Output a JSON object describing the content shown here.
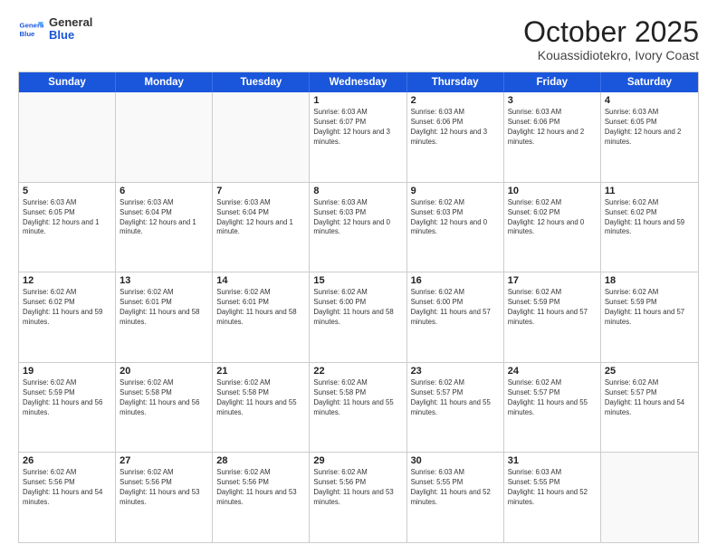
{
  "logo": {
    "line1": "General",
    "line2": "Blue"
  },
  "title": "October 2025",
  "location": "Kouassidiotekro, Ivory Coast",
  "weekdays": [
    "Sunday",
    "Monday",
    "Tuesday",
    "Wednesday",
    "Thursday",
    "Friday",
    "Saturday"
  ],
  "weeks": [
    [
      {
        "day": "",
        "empty": true
      },
      {
        "day": "",
        "empty": true
      },
      {
        "day": "",
        "empty": true
      },
      {
        "day": "1",
        "sunrise": "6:03 AM",
        "sunset": "6:07 PM",
        "daylight": "12 hours and 3 minutes."
      },
      {
        "day": "2",
        "sunrise": "6:03 AM",
        "sunset": "6:06 PM",
        "daylight": "12 hours and 3 minutes."
      },
      {
        "day": "3",
        "sunrise": "6:03 AM",
        "sunset": "6:06 PM",
        "daylight": "12 hours and 2 minutes."
      },
      {
        "day": "4",
        "sunrise": "6:03 AM",
        "sunset": "6:05 PM",
        "daylight": "12 hours and 2 minutes."
      }
    ],
    [
      {
        "day": "5",
        "sunrise": "6:03 AM",
        "sunset": "6:05 PM",
        "daylight": "12 hours and 1 minute."
      },
      {
        "day": "6",
        "sunrise": "6:03 AM",
        "sunset": "6:04 PM",
        "daylight": "12 hours and 1 minute."
      },
      {
        "day": "7",
        "sunrise": "6:03 AM",
        "sunset": "6:04 PM",
        "daylight": "12 hours and 1 minute."
      },
      {
        "day": "8",
        "sunrise": "6:03 AM",
        "sunset": "6:03 PM",
        "daylight": "12 hours and 0 minutes."
      },
      {
        "day": "9",
        "sunrise": "6:02 AM",
        "sunset": "6:03 PM",
        "daylight": "12 hours and 0 minutes."
      },
      {
        "day": "10",
        "sunrise": "6:02 AM",
        "sunset": "6:02 PM",
        "daylight": "12 hours and 0 minutes."
      },
      {
        "day": "11",
        "sunrise": "6:02 AM",
        "sunset": "6:02 PM",
        "daylight": "11 hours and 59 minutes."
      }
    ],
    [
      {
        "day": "12",
        "sunrise": "6:02 AM",
        "sunset": "6:02 PM",
        "daylight": "11 hours and 59 minutes."
      },
      {
        "day": "13",
        "sunrise": "6:02 AM",
        "sunset": "6:01 PM",
        "daylight": "11 hours and 58 minutes."
      },
      {
        "day": "14",
        "sunrise": "6:02 AM",
        "sunset": "6:01 PM",
        "daylight": "11 hours and 58 minutes."
      },
      {
        "day": "15",
        "sunrise": "6:02 AM",
        "sunset": "6:00 PM",
        "daylight": "11 hours and 58 minutes."
      },
      {
        "day": "16",
        "sunrise": "6:02 AM",
        "sunset": "6:00 PM",
        "daylight": "11 hours and 57 minutes."
      },
      {
        "day": "17",
        "sunrise": "6:02 AM",
        "sunset": "5:59 PM",
        "daylight": "11 hours and 57 minutes."
      },
      {
        "day": "18",
        "sunrise": "6:02 AM",
        "sunset": "5:59 PM",
        "daylight": "11 hours and 57 minutes."
      }
    ],
    [
      {
        "day": "19",
        "sunrise": "6:02 AM",
        "sunset": "5:59 PM",
        "daylight": "11 hours and 56 minutes."
      },
      {
        "day": "20",
        "sunrise": "6:02 AM",
        "sunset": "5:58 PM",
        "daylight": "11 hours and 56 minutes."
      },
      {
        "day": "21",
        "sunrise": "6:02 AM",
        "sunset": "5:58 PM",
        "daylight": "11 hours and 55 minutes."
      },
      {
        "day": "22",
        "sunrise": "6:02 AM",
        "sunset": "5:58 PM",
        "daylight": "11 hours and 55 minutes."
      },
      {
        "day": "23",
        "sunrise": "6:02 AM",
        "sunset": "5:57 PM",
        "daylight": "11 hours and 55 minutes."
      },
      {
        "day": "24",
        "sunrise": "6:02 AM",
        "sunset": "5:57 PM",
        "daylight": "11 hours and 55 minutes."
      },
      {
        "day": "25",
        "sunrise": "6:02 AM",
        "sunset": "5:57 PM",
        "daylight": "11 hours and 54 minutes."
      }
    ],
    [
      {
        "day": "26",
        "sunrise": "6:02 AM",
        "sunset": "5:56 PM",
        "daylight": "11 hours and 54 minutes."
      },
      {
        "day": "27",
        "sunrise": "6:02 AM",
        "sunset": "5:56 PM",
        "daylight": "11 hours and 53 minutes."
      },
      {
        "day": "28",
        "sunrise": "6:02 AM",
        "sunset": "5:56 PM",
        "daylight": "11 hours and 53 minutes."
      },
      {
        "day": "29",
        "sunrise": "6:02 AM",
        "sunset": "5:56 PM",
        "daylight": "11 hours and 53 minutes."
      },
      {
        "day": "30",
        "sunrise": "6:03 AM",
        "sunset": "5:55 PM",
        "daylight": "11 hours and 52 minutes."
      },
      {
        "day": "31",
        "sunrise": "6:03 AM",
        "sunset": "5:55 PM",
        "daylight": "11 hours and 52 minutes."
      },
      {
        "day": "",
        "empty": true
      }
    ]
  ],
  "labels": {
    "sunrise": "Sunrise:",
    "sunset": "Sunset:",
    "daylight": "Daylight hours"
  }
}
